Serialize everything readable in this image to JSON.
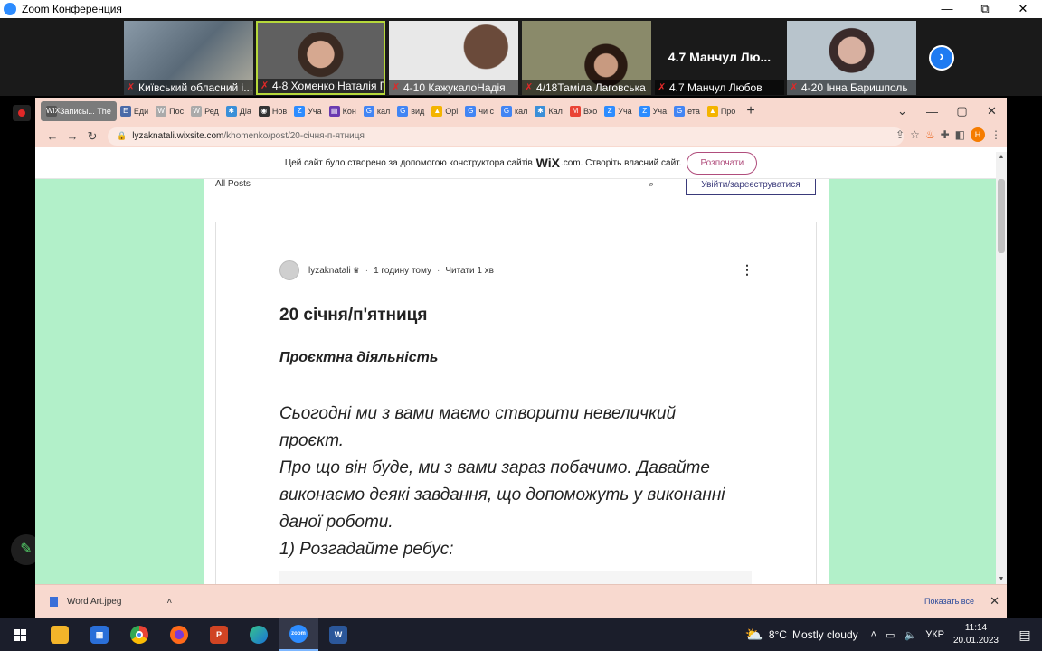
{
  "zoom": {
    "title": "Zoom Конференция",
    "controls": [
      "—",
      "⧉",
      "✕"
    ],
    "participants": [
      {
        "name": "Київський обласний і...",
        "type": "video",
        "color": "#6a7a8a"
      },
      {
        "name": "4-8 Хоменко Наталія П...",
        "type": "video",
        "color": "#5a5a5a"
      },
      {
        "name": "4-10 КажукалоНадія",
        "type": "video",
        "color": "#d8d8d8"
      },
      {
        "name": "4/18Таміла Лаговська",
        "type": "video",
        "color": "#8a8a6a"
      },
      {
        "name": "4.7 Манчул Любов",
        "type": "name",
        "big": "4.7  Манчул  Лю..."
      },
      {
        "name": "4-20 Інна Баришполь",
        "type": "video",
        "color": "#b8c4cc"
      }
    ],
    "next": "›"
  },
  "browser": {
    "tabs": [
      {
        "label": "Записы... The",
        "icon": "WIX",
        "color": "#555",
        "rec": true
      },
      {
        "label": "Еди",
        "icon": "E",
        "color": "#4a6aa8"
      },
      {
        "label": "Пос",
        "icon": "W",
        "color": "#aaa"
      },
      {
        "label": "Ред",
        "icon": "W",
        "color": "#aaa"
      },
      {
        "label": "Діа",
        "icon": "✱",
        "color": "#3a8fd8"
      },
      {
        "label": "Нов",
        "icon": "◉",
        "color": "#333"
      },
      {
        "label": "Уча",
        "icon": "Z",
        "color": "#2d8cff"
      },
      {
        "label": "Кон",
        "icon": "▤",
        "color": "#6a3ab0"
      },
      {
        "label": "кал",
        "icon": "G",
        "color": "#4285f4"
      },
      {
        "label": "вид",
        "icon": "G",
        "color": "#4285f4"
      },
      {
        "label": "Орі",
        "icon": "▲",
        "color": "#f4b400"
      },
      {
        "label": "чи с",
        "icon": "G",
        "color": "#4285f4"
      },
      {
        "label": "кал",
        "icon": "G",
        "color": "#4285f4"
      },
      {
        "label": "Кал",
        "icon": "✱",
        "color": "#3a8fd8"
      },
      {
        "label": "Вхо",
        "icon": "M",
        "color": "#ea4335"
      },
      {
        "label": "Уча",
        "icon": "Z",
        "color": "#2d8cff"
      },
      {
        "label": "Уча",
        "icon": "Z",
        "color": "#2d8cff"
      },
      {
        "label": "ета",
        "icon": "G",
        "color": "#4285f4"
      },
      {
        "label": "Про",
        "icon": "▲",
        "color": "#f4b400"
      }
    ],
    "new_tab": "+",
    "window_controls": [
      "⌄",
      "—",
      "▢",
      "✕"
    ],
    "nav": {
      "back": "←",
      "forward": "→",
      "reload": "↻"
    },
    "url_host": "lyzaknatali.wixsite.com",
    "url_path": "/khomenko/post/20-січня-п-ятниця",
    "profile": "Н"
  },
  "wix_banner": {
    "text_before": "Цей сайт було створено за допомогою конструктора сайтів",
    "brand": "WiX",
    "text_after": ".com. Створіть власний сайт.",
    "button": "Розпочати"
  },
  "blog": {
    "all_posts": "All Posts",
    "login": "Увійти/зареєструватися",
    "author": "lyzaknatali",
    "crown": "♛",
    "time": "1 годину тому",
    "read": "Читати 1 хв",
    "title_bold": "20",
    "title_rest": " січня/п'ятниця",
    "subtitle": "Проєктна діяльність",
    "body": [
      "Сьогодні ми з вами маємо створити невеличкий",
      "проєкт.",
      "Про що він буде, ми з вами зараз побачимо. Давайте",
      "виконаємо деякі завдання, що допоможуть у виконанні",
      "даної роботи.",
      "1) Розгадайте ребус:"
    ]
  },
  "downloads": {
    "file": "Word Art.jpeg",
    "show_all": "Показать все",
    "close": "✕"
  },
  "taskbar": {
    "temperature": "8°C",
    "weather": "Mostly cloudy",
    "language": "УКР",
    "time": "11:14",
    "date": "20.01.2023"
  }
}
